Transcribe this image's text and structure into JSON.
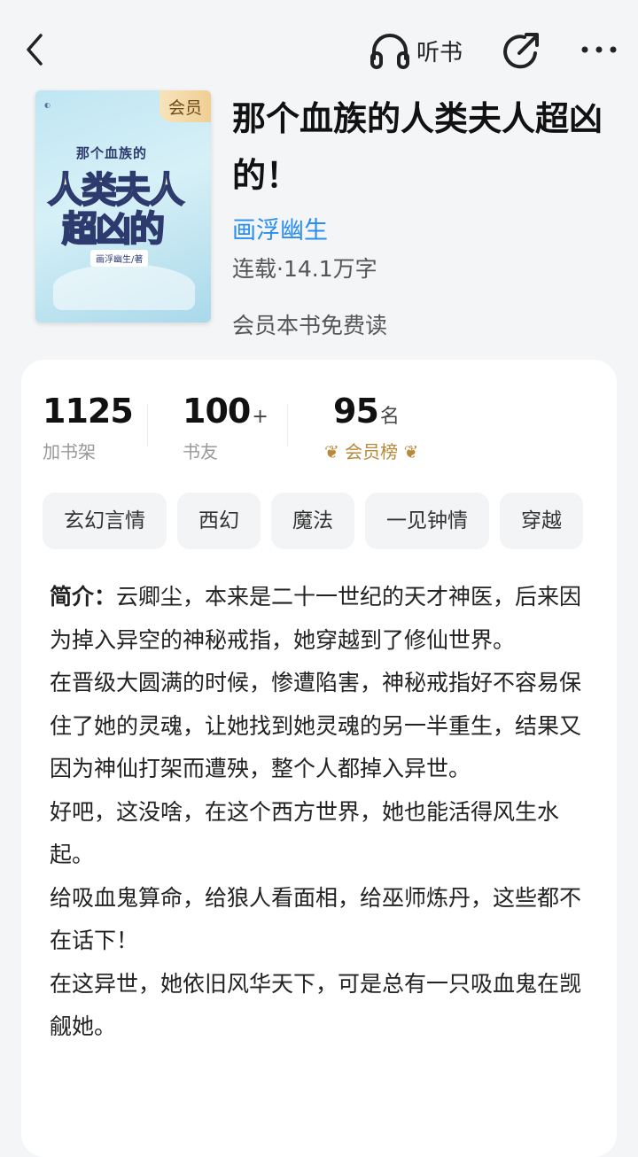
{
  "topbar": {
    "back_icon": "chevron-left-icon",
    "listen_label": "听书",
    "listen_icon": "headphones-icon",
    "share_icon": "share-icon",
    "more_icon": "more-icon"
  },
  "cover": {
    "badge": "会员",
    "small_title": "那个血族的",
    "line1": "人类夫人",
    "line2": "超凶的",
    "author_tag": "画浮幽生/著"
  },
  "book": {
    "title": "那个血族的人类夫人超凶的！",
    "author": "画浮幽生",
    "meta": "连载·14.1万字",
    "free_note": "会员本书免费读"
  },
  "stats": {
    "shelf_count": "1125",
    "shelf_label": "加书架",
    "friends_count": "100",
    "friends_suffix": "+",
    "friends_label": "书友",
    "rank": "95",
    "rank_suffix": "名",
    "rank_label": "会员榜"
  },
  "tags": [
    "玄幻言情",
    "西幻",
    "魔法",
    "一见钟情",
    "穿越"
  ],
  "synopsis": {
    "label": "简介：",
    "lines": [
      "云卿尘，本来是二十一世纪的天才神医，后来因为掉入异空的神秘戒指，她穿越到了修仙世界。",
      "在晋级大圆满的时候，惨遭陷害，神秘戒指好不容易保住了她的灵魂，让她找到她灵魂的另一半重生，结果又因为神仙打架而遭殃，整个人都掉入异世。",
      "好吧，这没啥，在这个西方世界，她也能活得风生水起。",
      "给吸血鬼算命，给狼人看面相，给巫师炼丹，这些都不在话下！",
      "在这异世，她依旧风华天下，可是总有一只吸血鬼在觊觎她。"
    ]
  },
  "colors": {
    "author_link": "#2a8df0",
    "badge_gold": "#efcf94",
    "rank_gold": "#b88a3a"
  }
}
